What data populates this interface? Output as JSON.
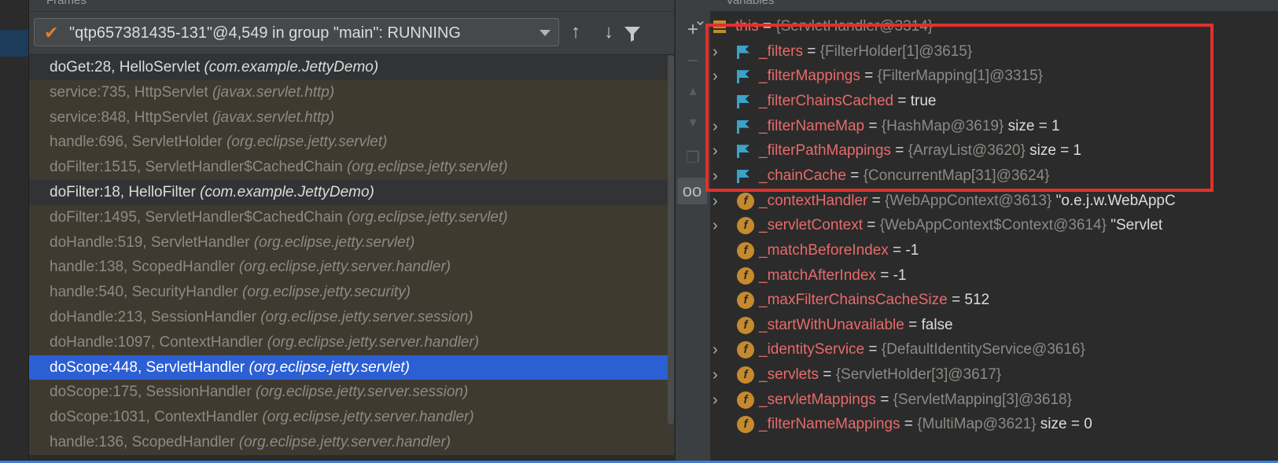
{
  "frames_panel": {
    "title": "Frames",
    "thread": "\"qtp657381435-131\"@4,549 in group \"main\": RUNNING",
    "frames": [
      {
        "method": "doGet:28, HelloServlet ",
        "pkg": "(com.example.JettyDemo)",
        "kind": "user"
      },
      {
        "method": "service:735, HttpServlet ",
        "pkg": "(javax.servlet.http)",
        "kind": "lib"
      },
      {
        "method": "service:848, HttpServlet ",
        "pkg": "(javax.servlet.http)",
        "kind": "lib"
      },
      {
        "method": "handle:696, ServletHolder ",
        "pkg": "(org.eclipse.jetty.servlet)",
        "kind": "lib"
      },
      {
        "method": "doFilter:1515, ServletHandler$CachedChain ",
        "pkg": "(org.eclipse.jetty.servlet)",
        "kind": "lib"
      },
      {
        "method": "doFilter:18, HelloFilter ",
        "pkg": "(com.example.JettyDemo)",
        "kind": "user"
      },
      {
        "method": "doFilter:1495, ServletHandler$CachedChain ",
        "pkg": "(org.eclipse.jetty.servlet)",
        "kind": "lib"
      },
      {
        "method": "doHandle:519, ServletHandler ",
        "pkg": "(org.eclipse.jetty.servlet)",
        "kind": "lib"
      },
      {
        "method": "handle:138, ScopedHandler ",
        "pkg": "(org.eclipse.jetty.server.handler)",
        "kind": "lib"
      },
      {
        "method": "handle:540, SecurityHandler ",
        "pkg": "(org.eclipse.jetty.security)",
        "kind": "lib"
      },
      {
        "method": "doHandle:213, SessionHandler ",
        "pkg": "(org.eclipse.jetty.server.session)",
        "kind": "lib"
      },
      {
        "method": "doHandle:1097, ContextHandler ",
        "pkg": "(org.eclipse.jetty.server.handler)",
        "kind": "lib"
      },
      {
        "method": "doScope:448, ServletHandler ",
        "pkg": "(org.eclipse.jetty.servlet)",
        "kind": "selected"
      },
      {
        "method": "doScope:175, SessionHandler ",
        "pkg": "(org.eclipse.jetty.server.session)",
        "kind": "lib"
      },
      {
        "method": "doScope:1031, ContextHandler ",
        "pkg": "(org.eclipse.jetty.server.handler)",
        "kind": "lib"
      },
      {
        "method": "handle:136, ScopedHandler ",
        "pkg": "(org.eclipse.jetty.server.handler)",
        "kind": "lib"
      }
    ]
  },
  "variables_panel": {
    "title": "Variables",
    "rows": [
      {
        "icon": "stack",
        "expand": "open",
        "name": "this",
        "eq": " = ",
        "value": "{ServletHandler@3314}",
        "extra": "",
        "indent": 0
      },
      {
        "icon": "flag",
        "expand": "closed",
        "name": "_filters",
        "eq": " = ",
        "value": "{FilterHolder[1]@3615}",
        "extra": "",
        "indent": 1
      },
      {
        "icon": "flag",
        "expand": "closed",
        "name": "_filterMappings",
        "eq": " = ",
        "value": "{FilterMapping[1]@3315}",
        "extra": "",
        "indent": 1
      },
      {
        "icon": "flag",
        "expand": "none",
        "name": "_filterChainsCached",
        "eq": " = ",
        "value": "true",
        "extra": "",
        "indent": 1
      },
      {
        "icon": "flag",
        "expand": "closed",
        "name": "_filterNameMap",
        "eq": " = ",
        "value": "{HashMap@3619}",
        "extra": "  size = 1",
        "indent": 1
      },
      {
        "icon": "flag",
        "expand": "closed",
        "name": "_filterPathMappings",
        "eq": " = ",
        "value": "{ArrayList@3620}",
        "extra": "  size = 1",
        "indent": 1
      },
      {
        "icon": "flag",
        "expand": "closed",
        "name": "_chainCache",
        "eq": " = ",
        "value": "{ConcurrentMap[31]@3624}",
        "extra": "",
        "indent": 1
      },
      {
        "icon": "field",
        "expand": "closed",
        "name": "_contextHandler",
        "eq": " = ",
        "value": "{WebAppContext@3613}",
        "extra": " \"o.e.j.w.WebAppC",
        "indent": 1
      },
      {
        "icon": "field",
        "expand": "closed",
        "name": "_servletContext",
        "eq": " = ",
        "value": "{WebAppContext$Context@3614}",
        "extra": " \"Servlet",
        "indent": 1
      },
      {
        "icon": "field",
        "expand": "none",
        "name": "_matchBeforeIndex",
        "eq": " = ",
        "value": "-1",
        "extra": "",
        "indent": 1
      },
      {
        "icon": "field",
        "expand": "none",
        "name": "_matchAfterIndex",
        "eq": " = ",
        "value": "-1",
        "extra": "",
        "indent": 1
      },
      {
        "icon": "field",
        "expand": "none",
        "name": "_maxFilterChainsCacheSize",
        "eq": " = ",
        "value": "512",
        "extra": "",
        "indent": 1
      },
      {
        "icon": "field",
        "expand": "none",
        "name": "_startWithUnavailable",
        "eq": " = ",
        "value": "false",
        "extra": "",
        "indent": 1
      },
      {
        "icon": "field",
        "expand": "closed",
        "name": "_identityService",
        "eq": " = ",
        "value": "{DefaultIdentityService@3616}",
        "extra": "",
        "indent": 1
      },
      {
        "icon": "field",
        "expand": "closed",
        "name": "_servlets",
        "eq": " = ",
        "value": "{ServletHolder[3]@3617}",
        "extra": "",
        "indent": 1
      },
      {
        "icon": "field",
        "expand": "closed",
        "name": "_servletMappings",
        "eq": " = ",
        "value": "{ServletMapping[3]@3618}",
        "extra": "",
        "indent": 1
      },
      {
        "icon": "field",
        "expand": "none",
        "name": "_filterNameMappings",
        "eq": " = ",
        "value": "{MultiMap@3621}",
        "extra": "  size = 0",
        "indent": 1
      }
    ]
  },
  "colors": {
    "accent": "#2c5fd4",
    "highlight": "#e0312a",
    "field_name": "#e86a6a"
  }
}
